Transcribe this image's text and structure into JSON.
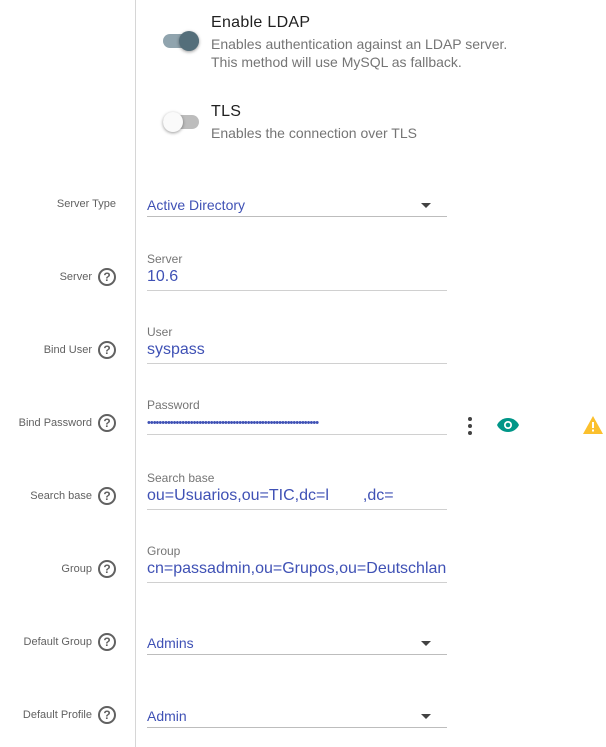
{
  "toggles": {
    "ldap": {
      "title": "Enable LDAP",
      "desc_line1": "Enables authentication against an LDAP server.",
      "desc_line2": "This method will use MySQL as fallback.",
      "state": "on"
    },
    "tls": {
      "title": "TLS",
      "desc_line1": "Enables the connection over TLS",
      "state": "off"
    }
  },
  "form": {
    "server_type": {
      "row_label": "Server Type",
      "value": "Active Directory"
    },
    "server": {
      "row_label": "Server",
      "field_label": "Server",
      "value": "10.6"
    },
    "bind_user": {
      "row_label": "Bind User",
      "field_label": "User",
      "value": "syspass"
    },
    "bind_password": {
      "row_label": "Bind Password",
      "field_label": "Password",
      "value": "••••••••••••••••••••••••••••••••••••••••••••••••••••••••••••"
    },
    "search_base": {
      "row_label": "Search base",
      "field_label": "Search base",
      "value_part1": "ou=Usuarios,ou=TIC,dc=l",
      "value_part2": ",dc="
    },
    "group": {
      "row_label": "Group",
      "field_label": "Group",
      "value": "cn=passadmin,ou=Grupos,ou=Deutschlan"
    },
    "default_group": {
      "row_label": "Default Group",
      "value": "Admins"
    },
    "default_profile": {
      "row_label": "Default Profile",
      "value": "Admin"
    }
  },
  "icons": {
    "help": "help-circle-icon",
    "kebab": "more-vert-icon",
    "eye": "visibility-icon",
    "warning": "warning-icon"
  },
  "colors": {
    "accent": "#3f51b5",
    "eye": "#009688",
    "warning": "#fbc02d"
  },
  "help_glyph": "?"
}
